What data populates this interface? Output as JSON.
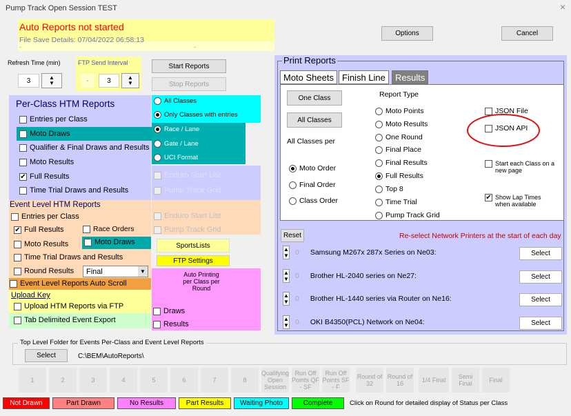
{
  "window": {
    "title": "Pump Track Open Session TEST",
    "close": "×"
  },
  "status": {
    "headline": "Auto Reports not started",
    "file_save": "File Save Details: 07/04/2022 06:58:13",
    "marker1": "-",
    "marker2": "-"
  },
  "buttons": {
    "options": "Options",
    "cancel": "Cancel",
    "start_reports": "Start Reports",
    "stop_reports": "Stop Reports"
  },
  "refresh": {
    "label": "Refresh Time (min)",
    "value": "3"
  },
  "ftp_interval": {
    "label": "FTP Send Interval",
    "prefix": "-",
    "value": "3"
  },
  "per_class": {
    "title": "Per-Class HTM Reports",
    "items": [
      {
        "label": "Entries per Class",
        "checked": ""
      },
      {
        "label": "Moto Draws",
        "checked": ""
      },
      {
        "label": "Qualifier & Final Draws and Results",
        "checked": ""
      },
      {
        "label": "Moto Results",
        "checked": ""
      },
      {
        "label": "Full Results",
        "checked": "✔"
      },
      {
        "label": "Time Trial Draws and Results",
        "checked": ""
      }
    ]
  },
  "class_options": {
    "all": "All Classes",
    "only": "Only Classes with entries",
    "race_lane": "Race / Lane",
    "gate_lane": "Gate / Lane",
    "uci": "UCI Format"
  },
  "greyed": {
    "enduro1": "Enduro Start List",
    "pump1": "Pump Track Grid",
    "enduro2": "Enduro Start List",
    "pump2": "Pump Track Grid"
  },
  "event_level": {
    "title": "Event Level HTM Reports",
    "entries": "Entries per Class",
    "full": "Full Results",
    "race_orders": "Race Orders",
    "moto_results": "Moto Results",
    "moto_draws": "Moto Draws",
    "tt": "Time Trial Draws and Results",
    "round_results": "Round Results",
    "round_value": "Final",
    "scroll": "Event Level Reports Auto Scroll",
    "upload_key": "Upload Key",
    "upload": "Upload HTM Reports via FTP",
    "tab_export": "Tab Delimited Event Export"
  },
  "sports": {
    "lists": "SportsLists",
    "ftp": "FTP Settings",
    "auto_title": "Auto Printing per Class per Round",
    "draws": "Draws",
    "results": "Results"
  },
  "print": {
    "title": "Print Reports",
    "tabs": [
      "Moto Sheets",
      "Finish Line",
      "Results"
    ],
    "one_class": "One Class",
    "all_classes": "All Classes",
    "all_classes_per": "All Classes per",
    "orders": [
      "Moto Order",
      "Final Order",
      "Class Order"
    ],
    "report_type": "Report Type",
    "types": [
      "Moto Points",
      "Moto Results",
      "One Round",
      "Final Place",
      "Final Results",
      "Full Results",
      "Top 8",
      "Time Trial",
      "Pump Track Grid"
    ],
    "json_file": "JSON File",
    "json_api": "JSON API",
    "each_class": "Start each Class on a new page",
    "lap_times": "Show Lap Times when available",
    "reset": "Reset",
    "reselect": "Re-select Network Printers at the start of each day",
    "printers": [
      {
        "count": "0",
        "name": "Samsung M267x 287x Series on Ne03:",
        "btn": "Select"
      },
      {
        "count": "0",
        "name": "Brother HL-2040 series on Ne27:",
        "btn": "Select"
      },
      {
        "count": "0",
        "name": "Brother HL-1440 series via Router on Ne16:",
        "btn": "Select"
      },
      {
        "count": "0",
        "name": "OKI B4350(PCL) Network on Ne04:",
        "btn": "Select"
      }
    ]
  },
  "folder": {
    "label": "Top Level Folder for Events Per-Class and Event Level Reports",
    "select": "Select",
    "path": "C:\\BEM\\AutoReports\\"
  },
  "rounds": [
    "1",
    "2",
    "3",
    "4",
    "5",
    "6",
    "7",
    "8",
    "Qualifying Open Session",
    "Run Off Points QF - SF",
    "Run Off Points SF - F",
    "Round of 32",
    "Round of 16",
    "1/4 Final",
    "Semi Final",
    "Final"
  ],
  "legend": [
    {
      "label": "Not Drawn",
      "color": "#ff0000"
    },
    {
      "label": "Part Drawn",
      "color": "#ff8080"
    },
    {
      "label": "No Results",
      "color": "#ff80ff"
    },
    {
      "label": "Part Results",
      "color": "#ffff00"
    },
    {
      "label": "Waiting Photo",
      "color": "#00ffff"
    },
    {
      "label": "Complete",
      "color": "#00ff00"
    }
  ],
  "legend_note": "Click on Round for detailed display of Status per Class",
  "colors": {
    "lavender": "#ccccff",
    "peach": "#ffdab9",
    "cyan": "#00ffff",
    "teal": "#00b0b0",
    "yellow": "#ffff99",
    "pink": "#ff99ff",
    "print_bg": "#ccccff"
  }
}
